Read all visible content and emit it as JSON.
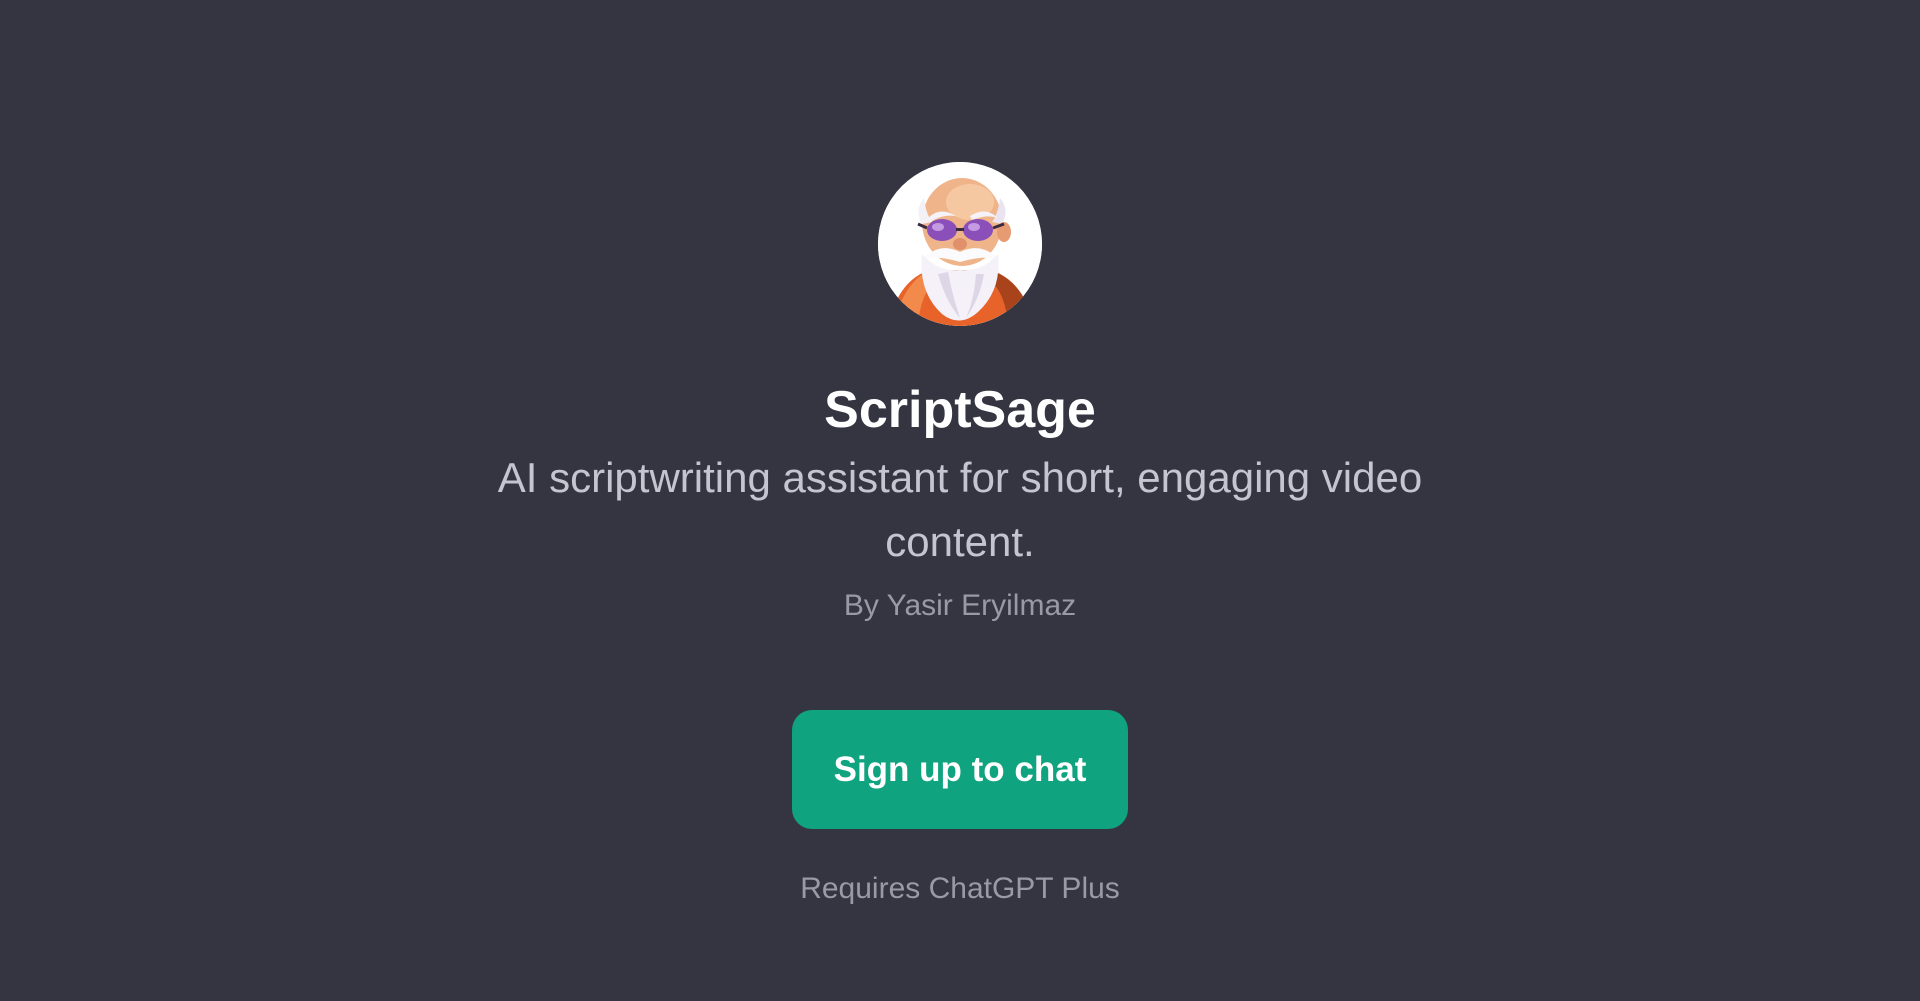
{
  "gpt": {
    "name": "ScriptSage",
    "description": "AI scriptwriting assistant for short, engaging video content.",
    "author": "By Yasir Eryilmaz",
    "avatar_icon": "bearded-old-man-avatar-icon"
  },
  "actions": {
    "signup_label": "Sign up to chat",
    "requirement": "Requires ChatGPT Plus"
  },
  "colors": {
    "background": "#343541",
    "button": "#10a37f",
    "title": "#ffffff",
    "description": "#c5c5d2",
    "muted": "#9a9aa6"
  }
}
